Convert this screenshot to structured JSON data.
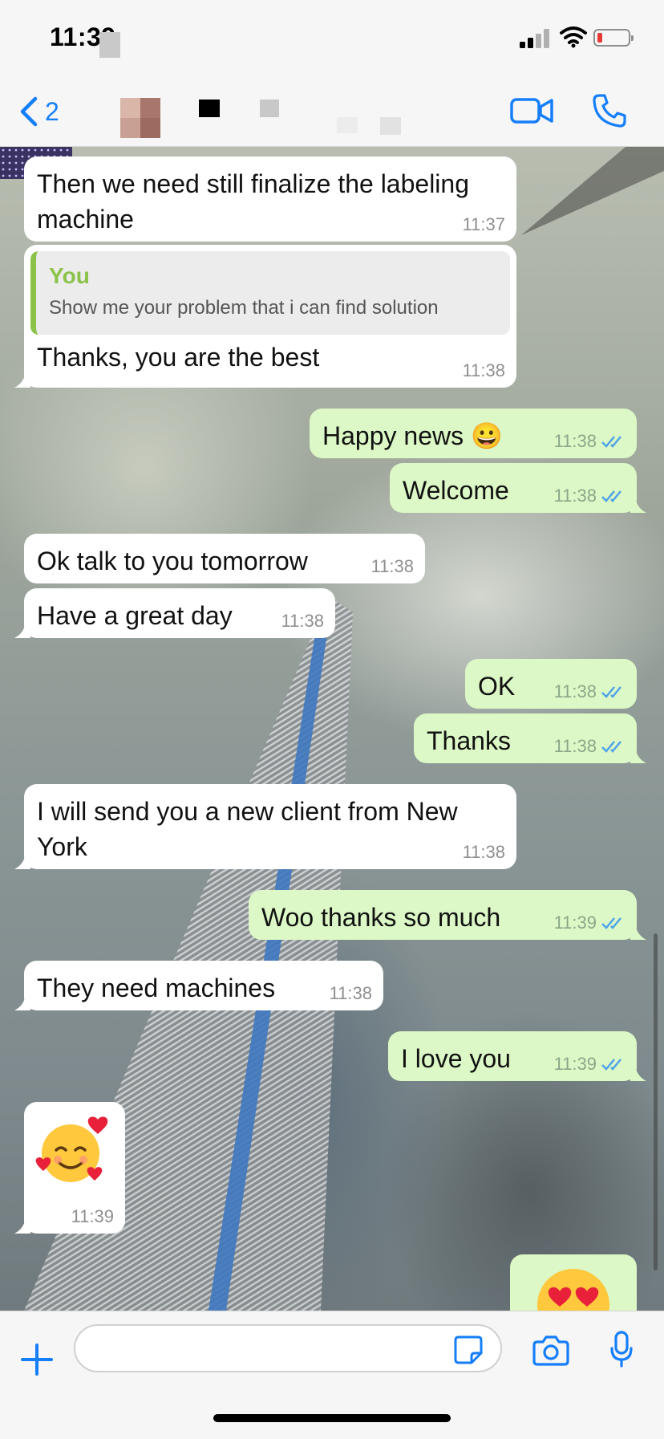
{
  "status_bar": {
    "time": "11:39"
  },
  "header": {
    "back_count": "2"
  },
  "messages": [
    {
      "direction": "in",
      "text_line1": "Then we need still finalize the labeling",
      "text_line2": "machine",
      "time": "11:37"
    },
    {
      "direction": "in",
      "quote_author": "You",
      "quote_text": "Show me your problem that i can find solution",
      "text": "Thanks, you are the best",
      "time": "11:38"
    },
    {
      "direction": "out",
      "text": "Happy news 😀",
      "time": "11:38"
    },
    {
      "direction": "out",
      "text": "Welcome",
      "time": "11:38"
    },
    {
      "direction": "in",
      "text": "Ok talk to you tomorrow",
      "time": "11:38"
    },
    {
      "direction": "in",
      "text": "Have a great day",
      "time": "11:38"
    },
    {
      "direction": "out",
      "text": "OK",
      "time": "11:38"
    },
    {
      "direction": "out",
      "text": "Thanks",
      "time": "11:38"
    },
    {
      "direction": "in",
      "text_line1": "I will send you a new client from New",
      "text_line2": "York",
      "time": "11:38"
    },
    {
      "direction": "out",
      "text": "Woo thanks so much",
      "time": "11:39"
    },
    {
      "direction": "in",
      "text": "They need machines",
      "time": "11:38"
    },
    {
      "direction": "out",
      "text": "I love you",
      "time": "11:39"
    },
    {
      "direction": "in",
      "emoji": "smiling-face-with-hearts",
      "time": "11:39"
    },
    {
      "direction": "out",
      "emoji": "heart-eyes-face"
    }
  ],
  "input": {
    "placeholder": ""
  },
  "colors": {
    "accent": "#157efb",
    "incoming_bubble": "#ffffff",
    "outgoing_bubble": "#dcf8c6",
    "read_ticks": "#4fa3e8",
    "quote_bar": "#8bc34a"
  },
  "icons": {
    "back": "chevron-left-icon",
    "video": "video-camera-icon",
    "call": "phone-icon",
    "plus": "plus-icon",
    "sticker": "sticker-icon",
    "camera": "camera-icon",
    "mic": "microphone-icon",
    "read": "double-check-icon"
  }
}
